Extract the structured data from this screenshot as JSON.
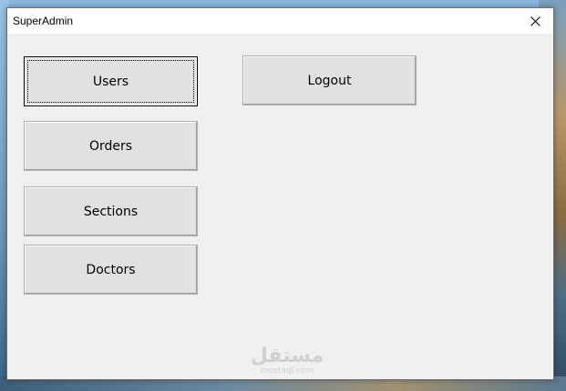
{
  "window": {
    "title": "SuperAdmin",
    "close_icon": "close-icon"
  },
  "buttons": {
    "users": "Users",
    "orders": "Orders",
    "sections": "Sections",
    "doctors": "Doctors",
    "logout": "Logout"
  },
  "focused_button": "users",
  "watermark": {
    "main": "مستقل",
    "sub": "mostaql.com"
  },
  "colors": {
    "window_bg": "#f0f0f0",
    "button_face": "#e1e1e1",
    "titlebar_bg": "#ffffff"
  }
}
